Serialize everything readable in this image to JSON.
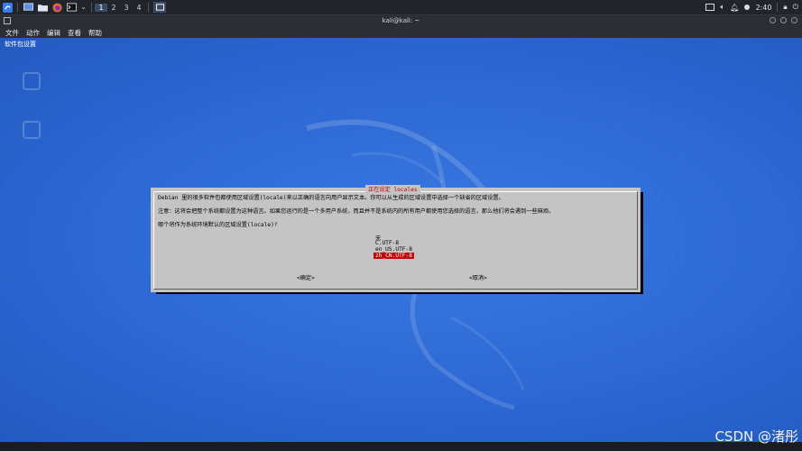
{
  "taskbar": {
    "workspaces": [
      "1",
      "2",
      "3",
      "4"
    ],
    "active_workspace": "1",
    "clock": "2:40",
    "icons": [
      "kali-menu-icon",
      "desktop-icon",
      "folder-icon",
      "firefox-icon",
      "terminal-icon",
      "window-icon"
    ]
  },
  "window": {
    "title": "kali@kali: ~",
    "menu": [
      "文件",
      "动作",
      "编辑",
      "查看",
      "帮助"
    ]
  },
  "desktop": {
    "label": "软件包设置"
  },
  "dialog": {
    "title": "正在设定 locales",
    "line1": "Debian 里的很多软件包都使用区域设置(locale)来以正确的语言向用户显示文本。你可以从生成的区域设置中选择一个缺省的区域设置。",
    "line2": "注意：这将会把整个系统都设置为这种语言。如果您运行的是一个多用户系统，而且并不是系统内的所有用户都使用您选择的语言，那么他们将会遇到一些麻烦。",
    "question": "哪个将作为系统环境默认的区域设置(locale)?",
    "options": [
      "无",
      "C.UTF-8",
      "en_US.UTF-8",
      "zh_CN.UTF-8"
    ],
    "ok": "<确定>",
    "cancel": "<取消>"
  },
  "watermark": "CSDN @渚彤",
  "colors": {
    "desktop_blue": "#2d68d4",
    "dialog_gray": "#c4c4c4",
    "selection_red": "#c40000",
    "title_red": "#c00000"
  }
}
